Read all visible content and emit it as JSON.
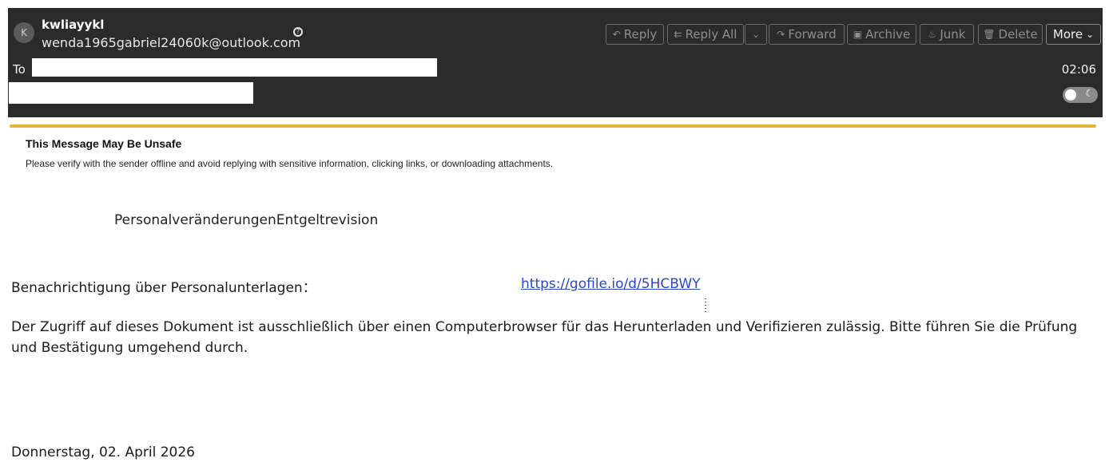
{
  "sender": {
    "initial": "K",
    "name": "kwliayykl",
    "email": "wenda1965gabriel24060k@outlook.com"
  },
  "toolbar": {
    "reply": "Reply",
    "reply_all": "Reply All",
    "forward": "Forward",
    "archive": "Archive",
    "junk": "Junk",
    "delete": "Delete",
    "more": "More"
  },
  "recipients": {
    "to_label": "To"
  },
  "time": "02:06",
  "warning": {
    "title": "This Message May Be Unsafe",
    "text": "Please verify with the sender offline and avoid replying with sensitive information, clicking links, or downloading attachments."
  },
  "message": {
    "heading": "PersonalveränderungenEntgeltrevision",
    "notice_label": "Benachrichtigung über Personalunterlagen：",
    "link": "https://gofile.io/d/5HCBWY",
    "paragraph_line1": "Der Zugriff auf dieses Dokument ist ausschließlich über einen Computerbrowser für das Herunterladen und Verifizieren zulässig. Bitte führen Sie die Prüfung",
    "paragraph_line2": "und Bestätigung umgehend durch.",
    "date": "Donnerstag, 02. April 2026"
  }
}
